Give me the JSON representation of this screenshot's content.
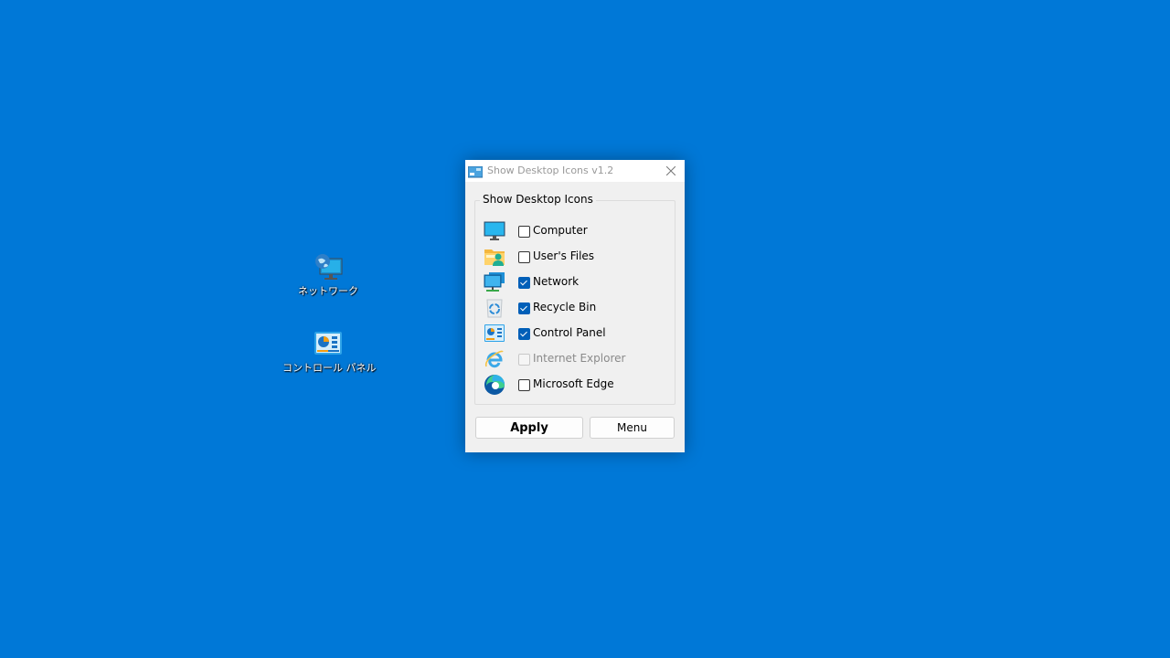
{
  "desktop": {
    "background_color": "#0078d7",
    "icons": [
      {
        "label": "ネットワーク",
        "icon": "network-icon"
      },
      {
        "label": "コントロール パネル",
        "icon": "control-panel-icon"
      }
    ]
  },
  "window": {
    "title": "Show Desktop Icons v1.2",
    "group_label": "Show Desktop Icons",
    "items": [
      {
        "label": "Computer",
        "icon": "computer-icon",
        "checked": false,
        "enabled": true
      },
      {
        "label": "User's Files",
        "icon": "user-folder-icon",
        "checked": false,
        "enabled": true
      },
      {
        "label": "Network",
        "icon": "network-icon",
        "checked": true,
        "enabled": true
      },
      {
        "label": "Recycle Bin",
        "icon": "recycle-bin-icon",
        "checked": true,
        "enabled": true
      },
      {
        "label": "Control Panel",
        "icon": "control-panel-icon",
        "checked": true,
        "enabled": true
      },
      {
        "label": "Internet Explorer",
        "icon": "internet-explorer-icon",
        "checked": false,
        "enabled": false
      },
      {
        "label": "Microsoft Edge",
        "icon": "microsoft-edge-icon",
        "checked": false,
        "enabled": true
      }
    ],
    "buttons": {
      "apply": "Apply",
      "menu": "Menu"
    },
    "accent_color": "#005fb8"
  }
}
